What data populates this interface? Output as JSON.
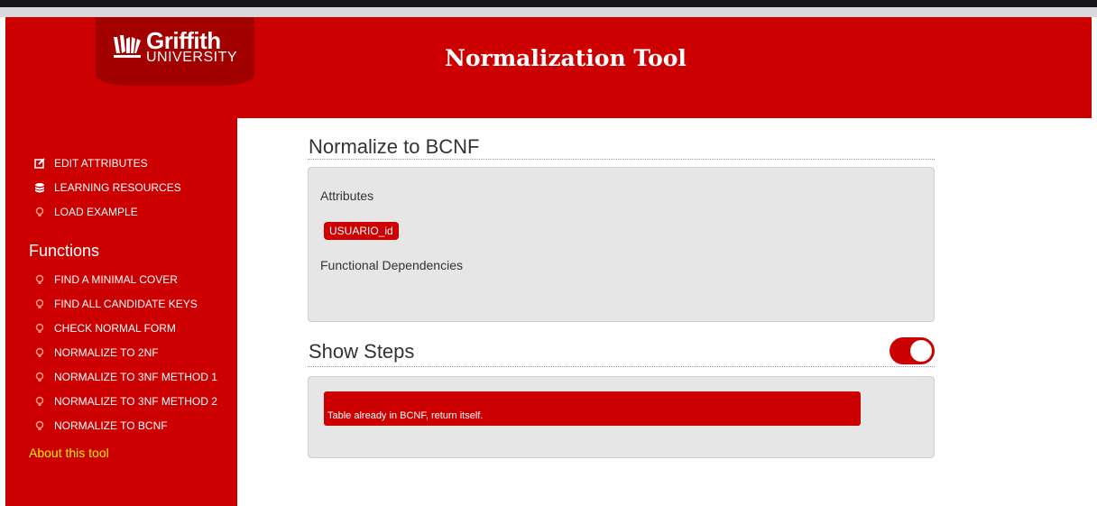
{
  "header": {
    "logo_name": "Griffith",
    "logo_sub": "UNIVERSITY",
    "title": "Normalization Tool"
  },
  "sidebar": {
    "top_items": [
      {
        "label": "EDIT ATTRIBUTES",
        "icon": "edit-icon"
      },
      {
        "label": "LEARNING RESOURCES",
        "icon": "database-icon"
      },
      {
        "label": "LOAD EXAMPLE",
        "icon": "lightbulb-icon"
      }
    ],
    "functions_heading": "Functions",
    "function_items": [
      {
        "label": "FIND A MINIMAL COVER",
        "icon": "lightbulb-icon"
      },
      {
        "label": "FIND ALL CANDIDATE KEYS",
        "icon": "lightbulb-icon"
      },
      {
        "label": "CHECK NORMAL FORM",
        "icon": "lightbulb-icon"
      },
      {
        "label": "NORMALIZE TO 2NF",
        "icon": "lightbulb-icon"
      },
      {
        "label": "NORMALIZE TO 3NF METHOD 1",
        "icon": "lightbulb-icon"
      },
      {
        "label": "NORMALIZE TO 3NF METHOD 2",
        "icon": "lightbulb-icon"
      },
      {
        "label": "NORMALIZE TO BCNF",
        "icon": "lightbulb-icon"
      }
    ],
    "about": "About this tool"
  },
  "main": {
    "heading": "Normalize to BCNF",
    "attributes_label": "Attributes",
    "attributes": [
      "USUARIO_id"
    ],
    "fd_label": "Functional Dependencies",
    "steps_heading": "Show Steps",
    "show_steps_on": true,
    "step_message": "Table already in BCNF, return itself."
  },
  "colors": {
    "brand_red": "#cc0000",
    "dark_red": "#a30000",
    "link_yellow": "#ffee00"
  }
}
